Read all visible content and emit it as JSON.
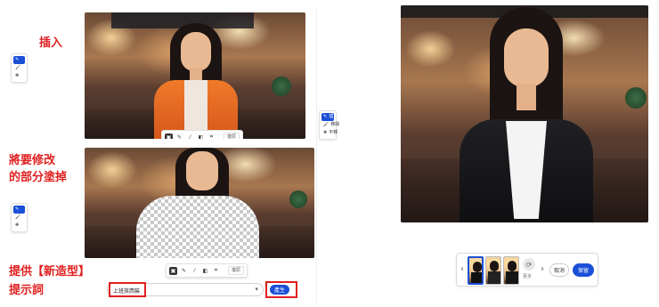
{
  "labels": {
    "insert": "插入",
    "erase_line1": "將要修改",
    "erase_line2": "的部分塗掉",
    "prompt_line1": "提供【新造型】",
    "prompt_line2": "提示詞"
  },
  "side_menu": {
    "items": [
      "插入",
      "移除",
      "平移"
    ]
  },
  "toolbar": {
    "undo_label": "復原"
  },
  "prompt_box": {
    "value": "上班族西裝",
    "generate_label": "產生"
  },
  "result_panel": {
    "cancel_label": "取消",
    "keep_label": "保留",
    "prev_icon": "‹",
    "next_icon": "›",
    "more_label": "更多"
  },
  "colors": {
    "annotation_red": "#e02020",
    "accent_blue": "#1a4fd8"
  }
}
